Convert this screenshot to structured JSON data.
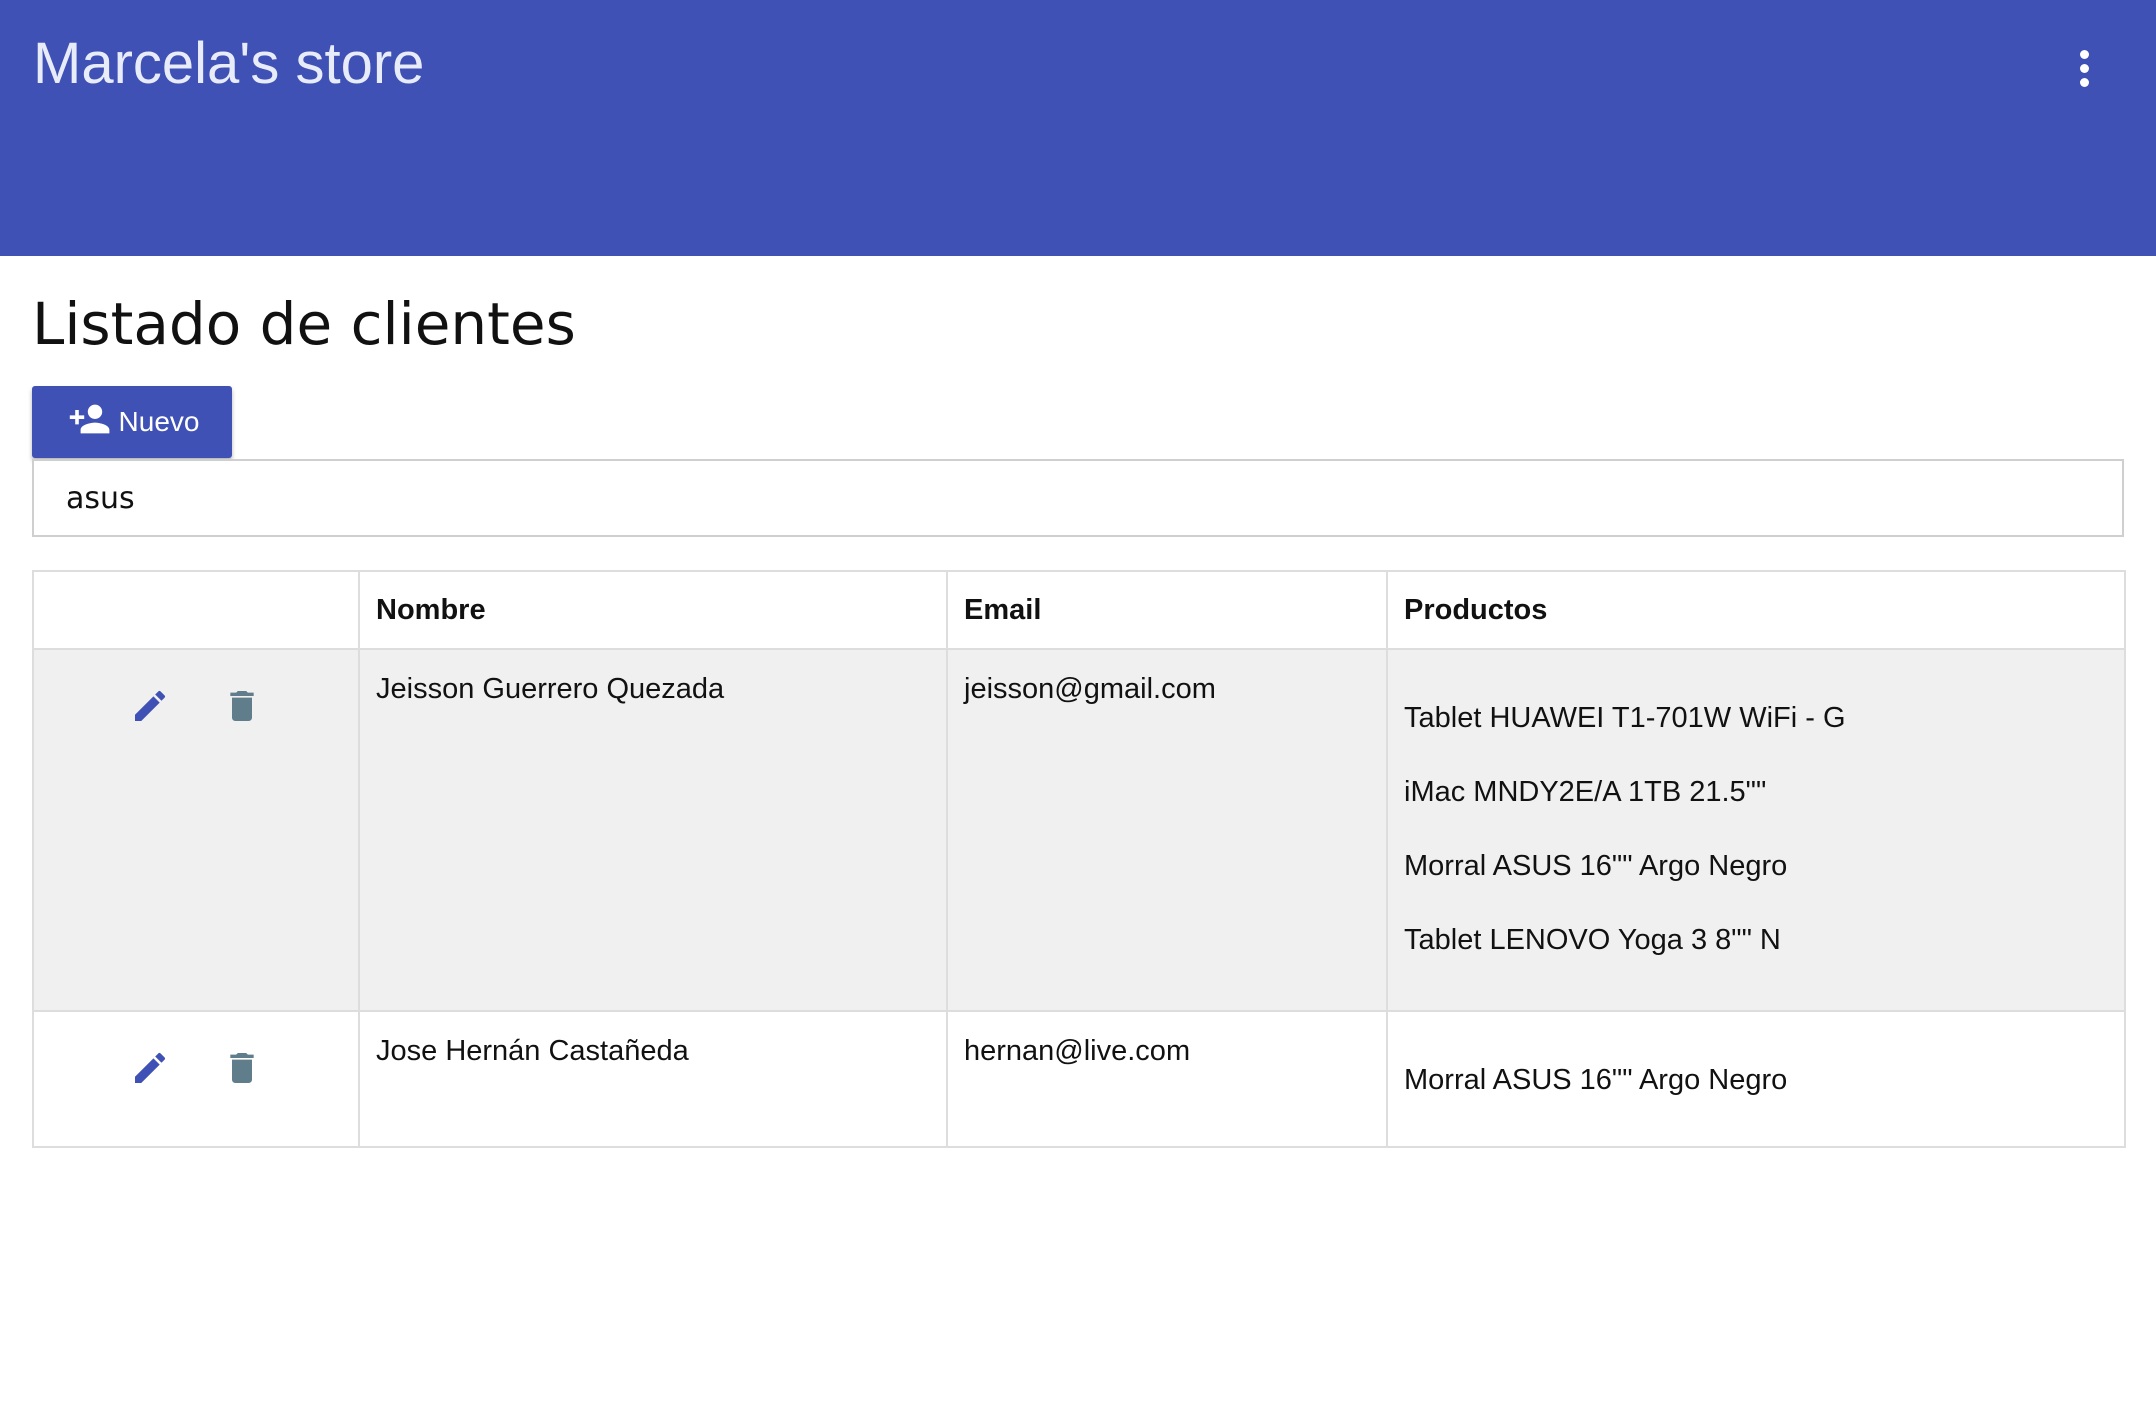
{
  "app": {
    "title": "Marcela's store",
    "menu_icon": "more-vert-icon",
    "primary_color": "#3f51b5"
  },
  "page": {
    "heading": "Listado de clientes"
  },
  "toolbar_actions": {
    "new_label": "Nuevo",
    "new_icon": "person-add-icon"
  },
  "search": {
    "value": "asus"
  },
  "table": {
    "headers": [
      "",
      "Nombre",
      "Email",
      "Productos"
    ],
    "rows": [
      {
        "name": "Jeisson Guerrero Quezada",
        "email": "jeisson@gmail.com",
        "products": [
          "Tablet HUAWEI T1-701W WiFi - G",
          "iMac MNDY2E/A 1TB 21.5\"\"",
          "Morral ASUS 16\"\" Argo Negro",
          "Tablet LENOVO Yoga 3 8\"\" N"
        ],
        "edit_icon": "pencil-icon",
        "delete_icon": "trash-icon"
      },
      {
        "name": "Jose Hernán Castañeda",
        "email": "hernan@live.com",
        "products": [
          "Morral ASUS 16\"\" Argo Negro"
        ],
        "edit_icon": "pencil-icon",
        "delete_icon": "trash-icon"
      }
    ]
  },
  "colors": {
    "edit_icon": "#3f51b5",
    "delete_icon": "#607d8b",
    "row_highlight": "#f0f0f0"
  }
}
